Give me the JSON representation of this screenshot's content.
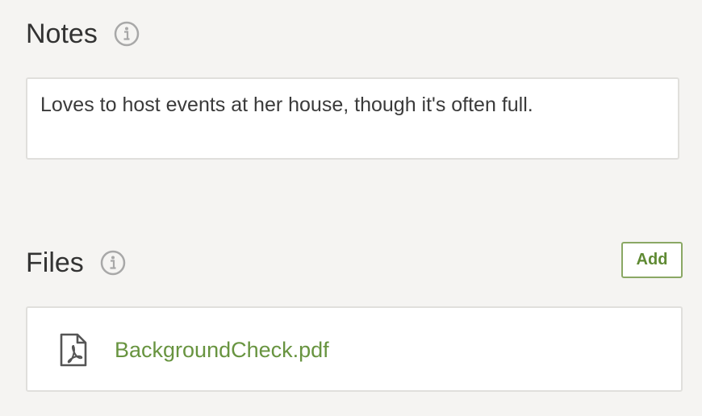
{
  "notes": {
    "title": "Notes",
    "info_icon": "info-icon",
    "text": "Loves to host events at her house, though it's often full."
  },
  "files": {
    "title": "Files",
    "info_icon": "info-icon",
    "add_label": "Add",
    "items": [
      {
        "name": "BackgroundCheck.pdf",
        "icon": "pdf-file-icon"
      }
    ]
  },
  "colors": {
    "background": "#f5f4f2",
    "accent_green": "#689440",
    "border": "#e0dfdc",
    "text": "#333333"
  }
}
